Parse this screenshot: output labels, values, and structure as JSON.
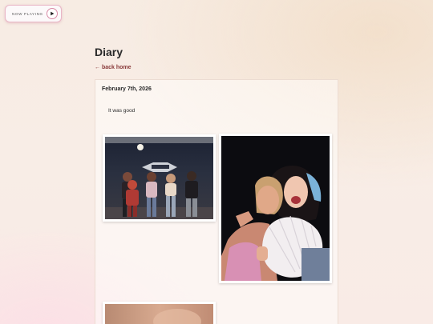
{
  "player": {
    "label": "NOW PLAYING",
    "play_icon": "play-icon"
  },
  "page": {
    "title": "Diary",
    "back_link": "← back home"
  },
  "entry": {
    "date": "February 7th, 2026",
    "text": "It was good"
  },
  "photos": [
    {
      "name": "group-photo"
    },
    {
      "name": "selfie-photo"
    },
    {
      "name": "third-photo"
    }
  ],
  "colors": {
    "accent_link": "#8a3b3b",
    "player_border": "#e9b6c6"
  }
}
